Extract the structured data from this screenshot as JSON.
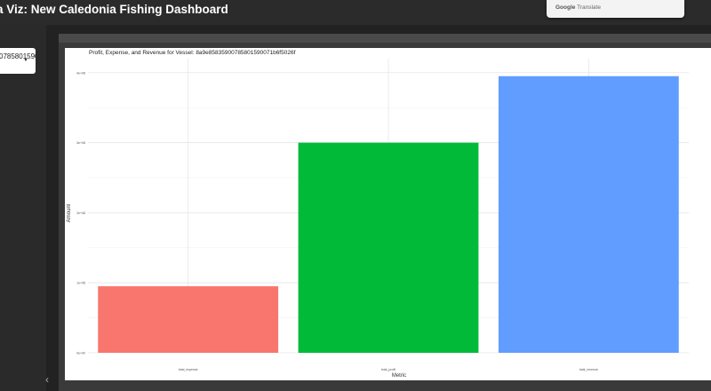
{
  "app": {
    "title": "a Viz: New Caledonia Fishing Dashboard"
  },
  "translate_popup": {
    "brand": "Google",
    "label": "Translate"
  },
  "sidebar": {
    "vessel_select_value": "0785801590"
  },
  "chart_data": {
    "type": "bar",
    "title": "Profit, Expense, and Revenue for Vessel: 8a9e85835900785801590071b6f5026f",
    "xlabel": "Metric",
    "ylabel": "Amount",
    "categories": [
      "total_expense",
      "total_profit",
      "total_revenue"
    ],
    "values": [
      0.95,
      3.0,
      3.95
    ],
    "colors": [
      "#F8766D",
      "#00BA38",
      "#619CFF"
    ],
    "ylim": [
      0,
      4.2
    ],
    "yticks": [
      0,
      1,
      2,
      3,
      4
    ],
    "yticklabels": [
      "0e+00",
      "1e+08",
      "2e+08",
      "3e+08",
      "4e+08"
    ],
    "grid": true
  }
}
